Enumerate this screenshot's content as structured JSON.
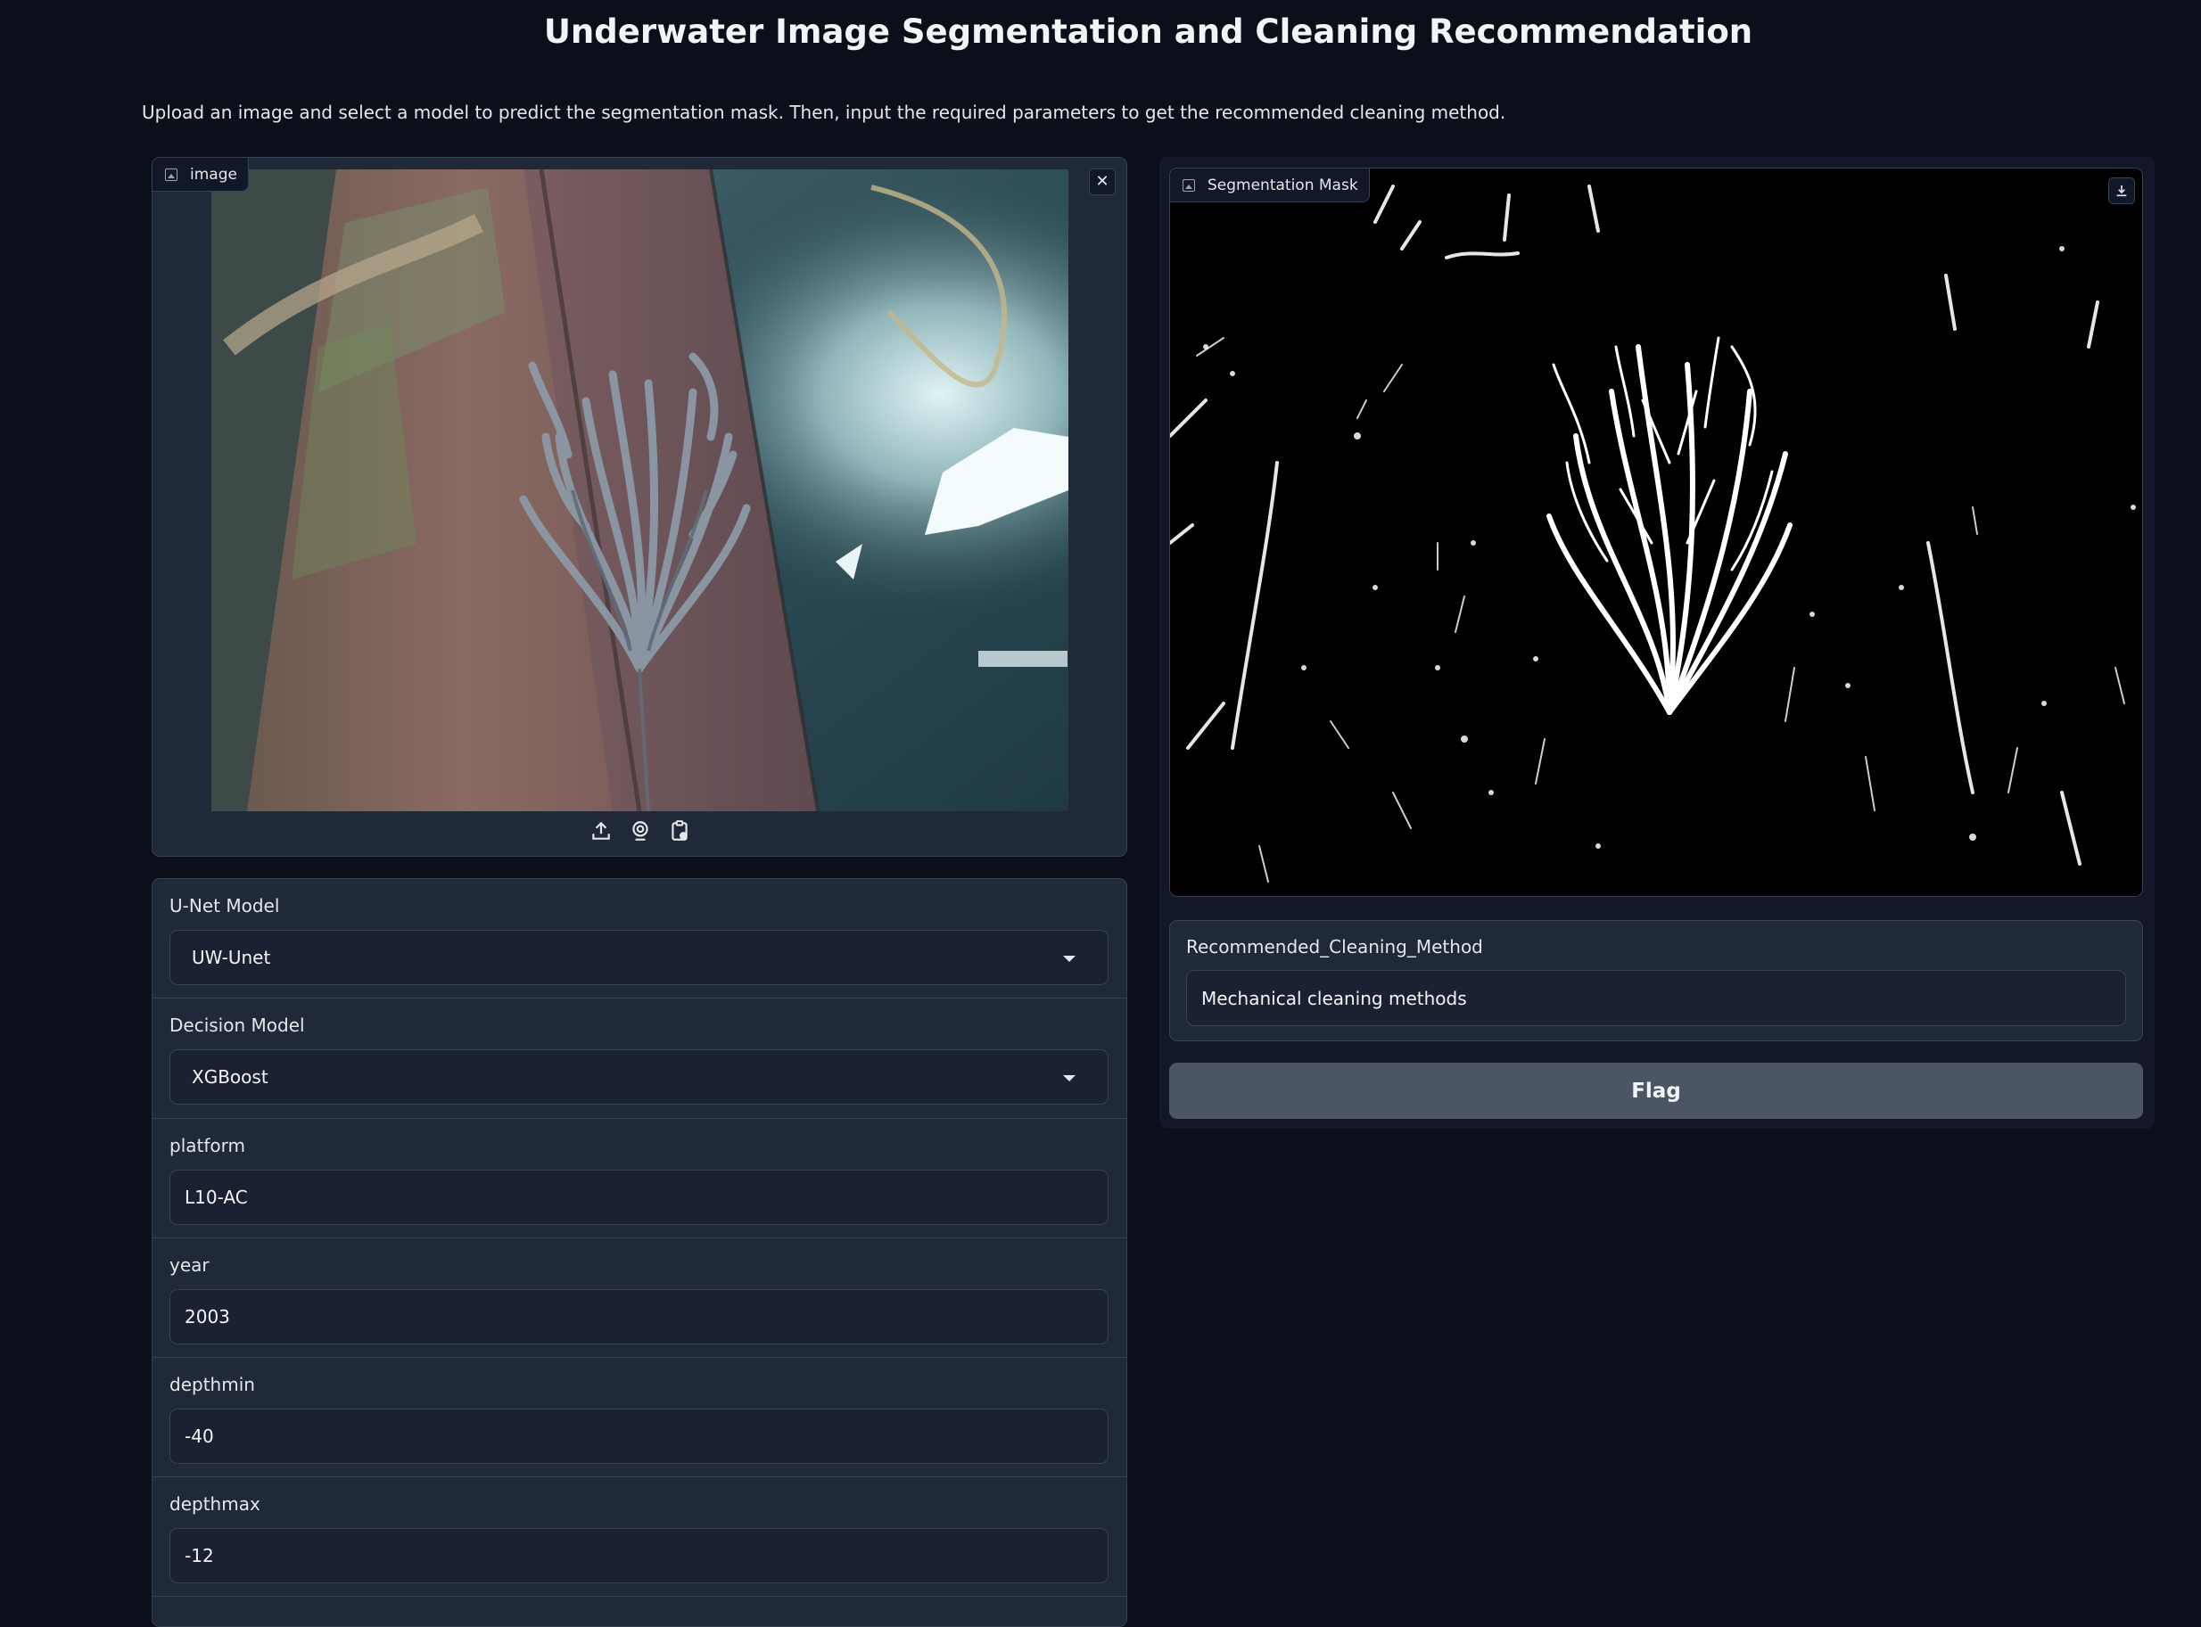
{
  "page": {
    "title": "Underwater Image Segmentation and Cleaning Recommendation",
    "description": "Upload an image and select a model to predict the segmentation mask. Then, input the required parameters to get the recommended cleaning method."
  },
  "image_input": {
    "label": "image",
    "label_icon": "image-icon",
    "clear_icon": "close-icon",
    "sources": [
      "upload-icon",
      "webcam-icon",
      "clipboard-icon"
    ]
  },
  "params": {
    "unet": {
      "label": "U-Net Model",
      "value": "UW-Unet"
    },
    "decision": {
      "label": "Decision Model",
      "value": "XGBoost"
    },
    "platform": {
      "label": "platform",
      "value": "L10-AC"
    },
    "year": {
      "label": "year",
      "value": "2003"
    },
    "depthmin": {
      "label": "depthmin",
      "value": "-40"
    },
    "depthmax": {
      "label": "depthmax",
      "value": "-12"
    }
  },
  "mask_output": {
    "label": "Segmentation Mask",
    "label_icon": "image-icon",
    "download_icon": "download-icon"
  },
  "result": {
    "label": "Recommended_Cleaning_Method",
    "value": "Mechanical cleaning methods"
  },
  "actions": {
    "flag_label": "Flag"
  },
  "colors": {
    "background": "#0b0f19",
    "panel": "#1f2937",
    "border": "#374151",
    "button": "#4b5563"
  }
}
